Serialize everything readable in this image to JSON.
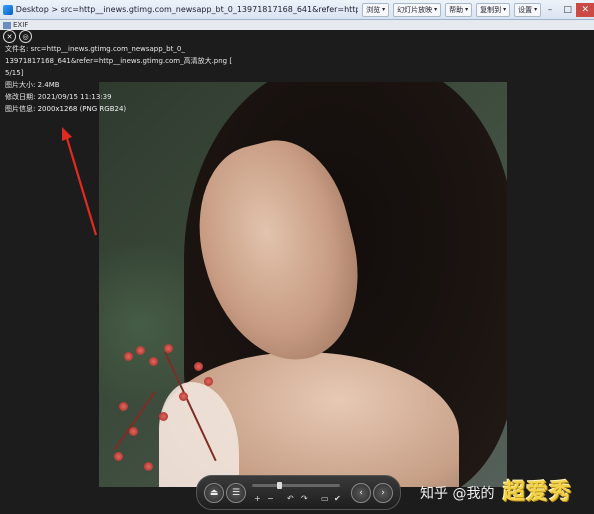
{
  "titlebar": {
    "title": "Desktop > src=http__inews.gtimg.com_newsapp_bt_0_13971817168_641&refer=http__inews.gtimg.com_高清放大.png [5/15] - 看图软件 5.40",
    "buttons": [
      "浏览",
      "幻灯片放映",
      "帮助",
      "复制到",
      "设置"
    ],
    "minimize": "–",
    "restore": "□",
    "close": "✕"
  },
  "menustrip": {
    "label": "EXIF"
  },
  "info": {
    "filename_line1": "文件名: src=http__inews.gtimg.com_newsapp_bt_0_",
    "filename_line2": "13971817168_641&refer=http__inews.gtimg.com_高清放大.png [",
    "filename_line3": "5/15]",
    "size": "图片大小: 2.4MB",
    "modified": "修改日期: 2021/09/15 11:13:39",
    "dimensions": "图片信息: 2000x1268 (PNG RGB24)"
  },
  "controls": {
    "zoom_in": "+",
    "zoom_out": "−",
    "rotate_left": "↶",
    "rotate_right": "↷"
  },
  "watermark": {
    "text": "知乎 @我的",
    "logo": "超爱秀"
  }
}
